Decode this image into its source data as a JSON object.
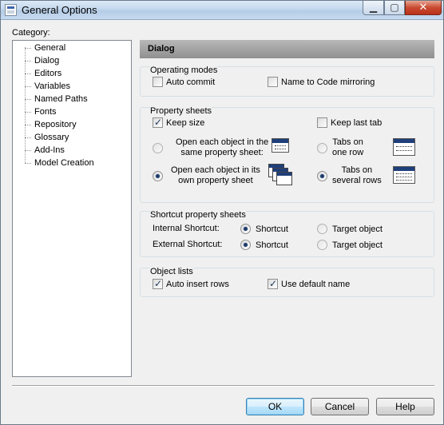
{
  "window": {
    "title": "General Options"
  },
  "titlebar_buttons": {
    "minimize": "▁",
    "maximize": "▢",
    "close": "✕"
  },
  "category_label": "Category:",
  "tree": [
    "General",
    "Dialog",
    "Editors",
    "Variables",
    "Named Paths",
    "Fonts",
    "Repository",
    "Glossary",
    "Add-Ins",
    "Model Creation"
  ],
  "panel_title": "Dialog",
  "operating_modes": {
    "title": "Operating modes",
    "auto_commit": "Auto commit",
    "name_to_code": "Name to Code mirroring"
  },
  "property_sheets": {
    "title": "Property sheets",
    "keep_size": "Keep size",
    "keep_last_tab": "Keep last tab",
    "open_same_1": "Open each object in the",
    "open_same_2": "same property sheet:",
    "open_own_1": "Open each object in its",
    "open_own_2": "own property sheet",
    "tabs_one_1": "Tabs on",
    "tabs_one_2": "one row",
    "tabs_several_1": "Tabs on",
    "tabs_several_2": "several rows"
  },
  "shortcut_sheets": {
    "title": "Shortcut property sheets",
    "internal": "Internal Shortcut:",
    "external": "External Shortcut:",
    "shortcut": "Shortcut",
    "target": "Target object"
  },
  "object_lists": {
    "title": "Object lists",
    "auto_insert": "Auto insert rows",
    "use_default": "Use default name"
  },
  "buttons": {
    "ok": "OK",
    "cancel": "Cancel",
    "help": "Help"
  }
}
